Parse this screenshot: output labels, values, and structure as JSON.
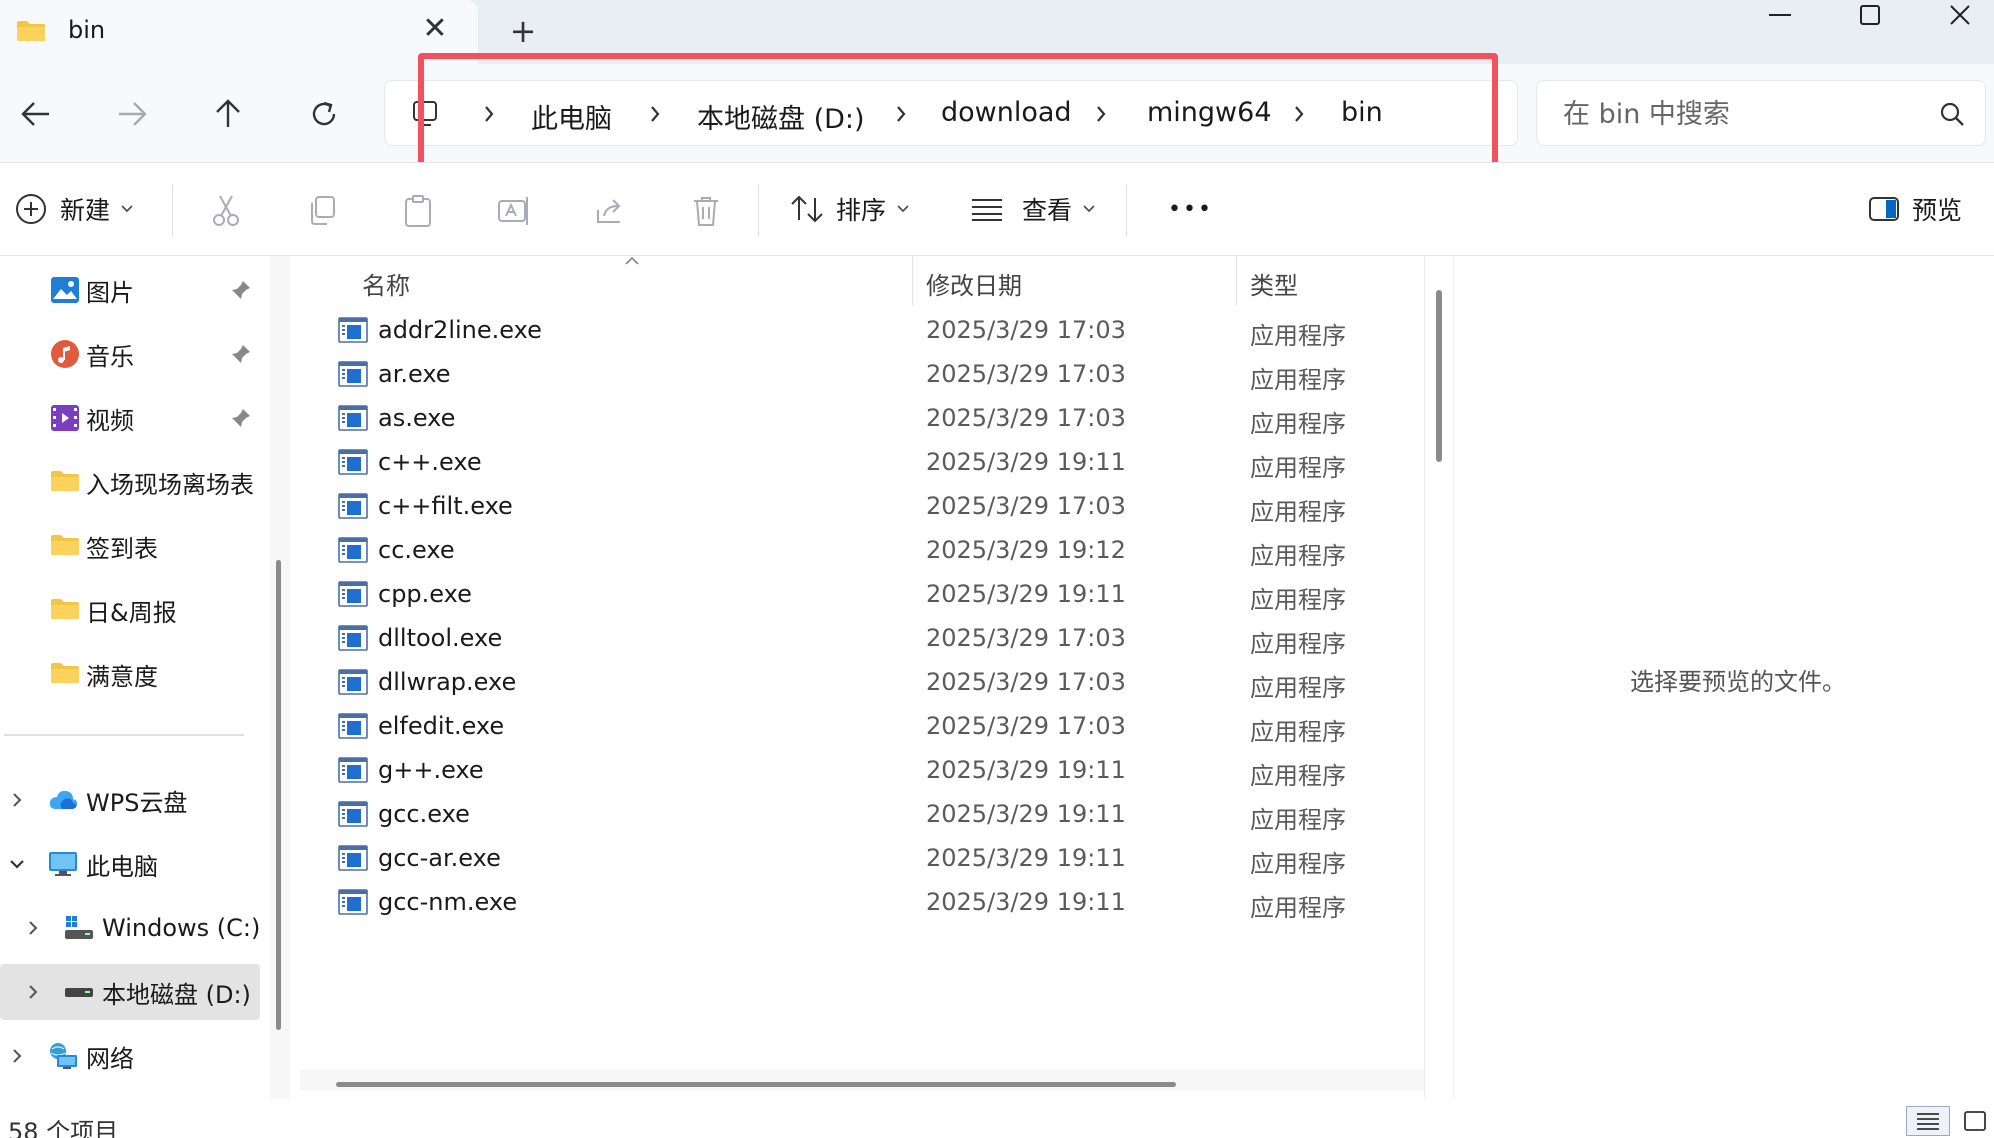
{
  "tab": {
    "title": "bin",
    "close": "✕",
    "new_tab": "+"
  },
  "address": {
    "crumbs": [
      "此电脑",
      "本地磁盘 (D:)",
      "download",
      "mingw64",
      "bin"
    ]
  },
  "search": {
    "placeholder": "在 bin 中搜索"
  },
  "toolbar": {
    "new_label": "新建",
    "sort_label": "排序",
    "view_label": "查看",
    "more_label": "•••",
    "preview_label": "预览"
  },
  "sidebar": {
    "quick_access": [
      {
        "label": "图片",
        "icon": "pictures-icon",
        "pinned": true
      },
      {
        "label": "音乐",
        "icon": "music-icon",
        "pinned": true
      },
      {
        "label": "视频",
        "icon": "video-icon",
        "pinned": true
      },
      {
        "label": "入场现场离场表",
        "icon": "folder-icon",
        "pinned": false
      },
      {
        "label": "签到表",
        "icon": "folder-icon",
        "pinned": false
      },
      {
        "label": "日&周报",
        "icon": "folder-icon",
        "pinned": false
      },
      {
        "label": "满意度",
        "icon": "folder-icon",
        "pinned": false
      }
    ],
    "tree": [
      {
        "label": "WPS云盘",
        "icon": "cloud-icon",
        "expanded": false
      },
      {
        "label": "此电脑",
        "icon": "computer-icon",
        "expanded": true
      },
      {
        "label": "Windows (C:)",
        "icon": "drive-c-icon",
        "expanded": false
      },
      {
        "label": "本地磁盘 (D:)",
        "icon": "drive-icon",
        "expanded": false,
        "selected": true
      },
      {
        "label": "网络",
        "icon": "network-icon",
        "expanded": false
      }
    ]
  },
  "filelist": {
    "columns": [
      "名称",
      "修改日期",
      "类型"
    ],
    "rows": [
      {
        "name": "addr2line.exe",
        "date": "2025/3/29 17:03",
        "type": "应用程序"
      },
      {
        "name": "ar.exe",
        "date": "2025/3/29 17:03",
        "type": "应用程序"
      },
      {
        "name": "as.exe",
        "date": "2025/3/29 17:03",
        "type": "应用程序"
      },
      {
        "name": "c++.exe",
        "date": "2025/3/29 19:11",
        "type": "应用程序"
      },
      {
        "name": "c++filt.exe",
        "date": "2025/3/29 17:03",
        "type": "应用程序"
      },
      {
        "name": "cc.exe",
        "date": "2025/3/29 19:12",
        "type": "应用程序"
      },
      {
        "name": "cpp.exe",
        "date": "2025/3/29 19:11",
        "type": "应用程序"
      },
      {
        "name": "dlltool.exe",
        "date": "2025/3/29 17:03",
        "type": "应用程序"
      },
      {
        "name": "dllwrap.exe",
        "date": "2025/3/29 17:03",
        "type": "应用程序"
      },
      {
        "name": "elfedit.exe",
        "date": "2025/3/29 17:03",
        "type": "应用程序"
      },
      {
        "name": "g++.exe",
        "date": "2025/3/29 19:11",
        "type": "应用程序"
      },
      {
        "name": "gcc.exe",
        "date": "2025/3/29 19:11",
        "type": "应用程序"
      },
      {
        "name": "gcc-ar.exe",
        "date": "2025/3/29 19:11",
        "type": "应用程序"
      },
      {
        "name": "gcc-nm.exe",
        "date": "2025/3/29 19:11",
        "type": "应用程序"
      }
    ]
  },
  "preview": {
    "message": "选择要预览的文件。"
  },
  "status": {
    "item_count": "58 个项目"
  },
  "colors": {
    "highlight": "#f25260",
    "accent": "#0067c0",
    "folder": "#f4c542"
  }
}
